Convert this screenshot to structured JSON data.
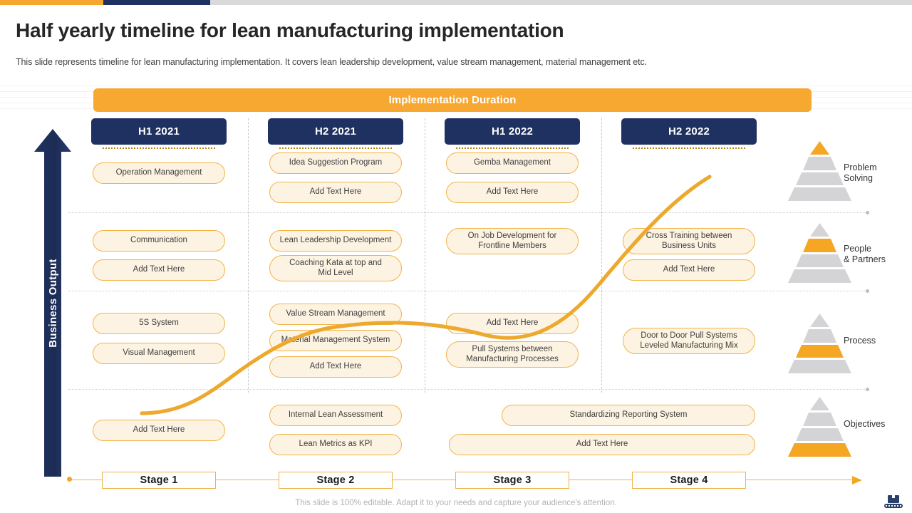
{
  "meta": {
    "accent_orange": "#f5a631",
    "accent_navy": "#1f3160",
    "pill_fill": "#fdf3e2",
    "pill_border": "#f2b346",
    "pyramid_gray": "#d4d4d6"
  },
  "topbar": {
    "segments": [
      {
        "name": "orange",
        "color": "#f5a631"
      },
      {
        "name": "navy",
        "color": "#1f3160"
      },
      {
        "name": "gray",
        "color": "#d9d9d9"
      }
    ]
  },
  "header": {
    "title": "Half yearly timeline for lean manufacturing implementation",
    "subtitle": "This slide represents timeline for lean manufacturing implementation. It covers lean leadership development, value stream management, material management etc."
  },
  "banner": {
    "label": "Implementation Duration"
  },
  "axis": {
    "vertical_label": "Business Output"
  },
  "columns": [
    {
      "id": "h1-2021",
      "label": "H1 2021"
    },
    {
      "id": "h2-2021",
      "label": "H2 2021"
    },
    {
      "id": "h1-2022",
      "label": "H1 2022"
    },
    {
      "id": "h2-2022",
      "label": "H2 2022"
    }
  ],
  "rows": [
    {
      "id": "problem-solving",
      "label": "Problem\nSolving",
      "label_line1": "Problem",
      "label_line2": "Solving",
      "pyramid_highlight_tier": 1,
      "cells": [
        {
          "column": "h1-2021",
          "items": [
            "Operation Management"
          ]
        },
        {
          "column": "h2-2021",
          "items": [
            "Idea Suggestion Program",
            "Add Text Here"
          ]
        },
        {
          "column": "h1-2022",
          "items": [
            "Gemba Management",
            "Add Text Here"
          ]
        },
        {
          "column": "h2-2022",
          "items": []
        }
      ]
    },
    {
      "id": "people-partners",
      "label": "People\n& Partners",
      "label_line1": "People",
      "label_line2": "& Partners",
      "pyramid_highlight_tier": 2,
      "cells": [
        {
          "column": "h1-2021",
          "items": [
            "Communication",
            "Add Text Here"
          ]
        },
        {
          "column": "h2-2021",
          "items": [
            "Lean Leadership Development",
            "Coaching Kata at top and Mid Level"
          ]
        },
        {
          "column": "h1-2022",
          "items": [
            "On Job Development for Frontline Members"
          ]
        },
        {
          "column": "h2-2022",
          "items": [
            "Cross Training between Business Units",
            "Add Text Here"
          ]
        }
      ]
    },
    {
      "id": "process",
      "label": "Process",
      "label_line1": "Process",
      "label_line2": "",
      "pyramid_highlight_tier": 3,
      "cells": [
        {
          "column": "h1-2021",
          "items": [
            "5S System",
            "Visual Management"
          ]
        },
        {
          "column": "h2-2021",
          "items": [
            "Value Stream Management",
            "Material Management System",
            "Add Text Here"
          ]
        },
        {
          "column": "h1-2022",
          "items": [
            "Add Text Here",
            "Pull Systems between Manufacturing Processes"
          ]
        },
        {
          "column": "h2-2022",
          "items": [
            "Door to Door Pull Systems Leveled Manufacturing Mix"
          ]
        }
      ]
    },
    {
      "id": "objectives",
      "label": "Objectives",
      "label_line1": "Objectives",
      "label_line2": "",
      "pyramid_highlight_tier": 4,
      "cells": [
        {
          "column": "h1-2021",
          "items": [
            "Add Text Here"
          ]
        },
        {
          "column": "h2-2021",
          "items": [
            "Internal Lean Assessment",
            "Lean Metrics as KPI"
          ]
        },
        {
          "column": "h1-2022+h2-2022",
          "items": [
            "Standardizing Reporting System",
            "Add Text Here"
          ]
        }
      ]
    }
  ],
  "pills": {
    "r1c1_1": "Operation Management",
    "r1c2_1": "Idea Suggestion Program",
    "r1c2_2": "Add Text Here",
    "r1c3_1": "Gemba Management",
    "r1c3_2": "Add Text Here",
    "r2c1_1": "Communication",
    "r2c1_2": "Add Text Here",
    "r2c2_1": "Lean Leadership Development",
    "r2c2_2a": "Coaching Kata at top and",
    "r2c2_2b": "Mid Level",
    "r2c3_1a": "On Job Development for",
    "r2c3_1b": "Frontline Members",
    "r2c4_1a": "Cross Training between",
    "r2c4_1b": "Business Units",
    "r2c4_2": "Add Text Here",
    "r3c1_1": "5S System",
    "r3c1_2": "Visual Management",
    "r3c2_1": "Value Stream Management",
    "r3c2_2": "Material Management System",
    "r3c2_3": "Add Text Here",
    "r3c3_1": "Add Text Here",
    "r3c3_2a": "Pull Systems between",
    "r3c3_2b": "Manufacturing Processes",
    "r3c4_1a": "Door to Door Pull Systems",
    "r3c4_1b": "Leveled Manufacturing Mix",
    "r4c1_1": "Add Text Here",
    "r4c2_1": "Internal Lean Assessment",
    "r4c2_2": "Lean Metrics as KPI",
    "r4wide_1": "Standardizing Reporting System",
    "r4wide_2": "Add Text Here"
  },
  "stages": [
    {
      "id": "stage-1",
      "label": "Stage 1"
    },
    {
      "id": "stage-2",
      "label": "Stage 2"
    },
    {
      "id": "stage-3",
      "label": "Stage 3"
    },
    {
      "id": "stage-4",
      "label": "Stage 4"
    }
  ],
  "footer": {
    "note": "This slide is 100% editable. Adapt it to your needs and capture your audience's attention."
  }
}
